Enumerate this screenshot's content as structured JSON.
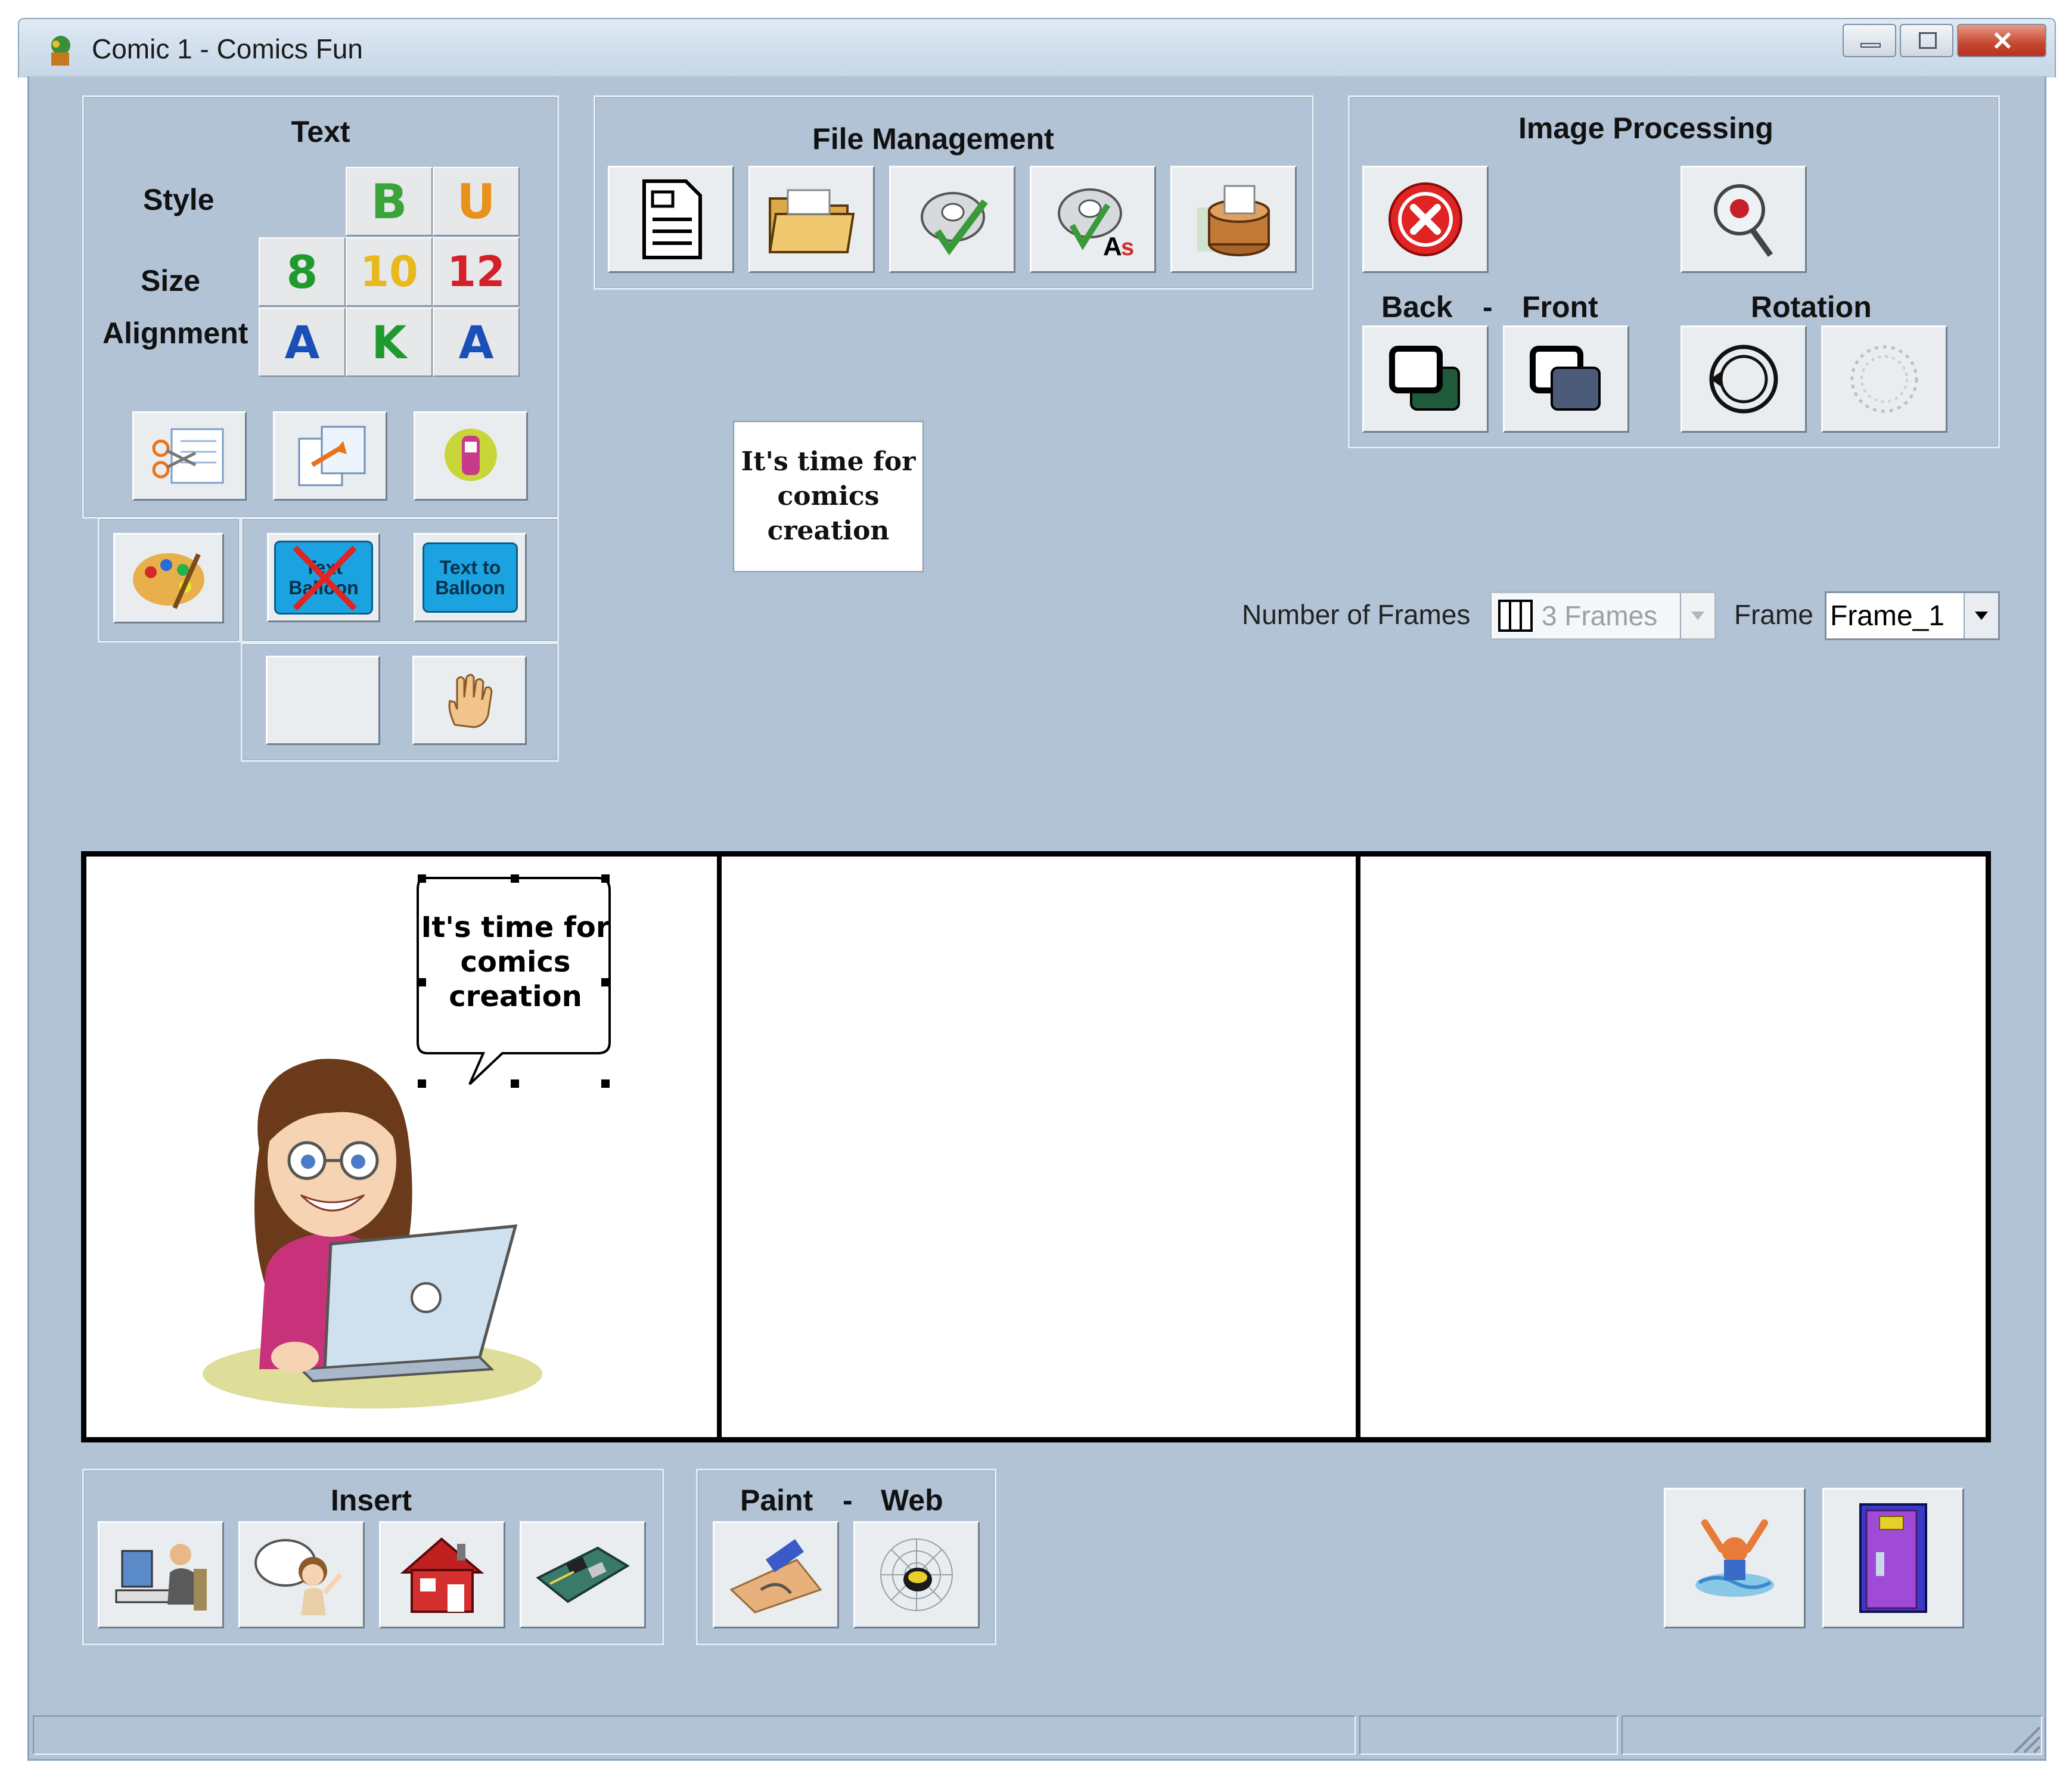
{
  "window": {
    "title": "Comic 1 - Comics Fun",
    "controls": {
      "minimize": "minimize-icon",
      "maximize": "maximize-icon",
      "close": "close-icon"
    }
  },
  "text_group": {
    "title": "Text",
    "style_label": "Style",
    "size_label": "Size",
    "alignment_label": "Alignment",
    "style_buttons": [
      "B",
      "U"
    ],
    "size_buttons": [
      "8",
      "10",
      "12"
    ],
    "alignment_buttons": [
      "A",
      "K",
      "A"
    ],
    "balloon_buttons": {
      "remove": "Text Balloon",
      "to": "Text to Balloon"
    }
  },
  "file_management": {
    "title": "File Management"
  },
  "image_processing": {
    "title": "Image Processing",
    "back_label": "Back",
    "dash": "-",
    "front_label": "Front",
    "rotation_label": "Rotation"
  },
  "preview": {
    "text": "It's time for comics creation"
  },
  "frames_bar": {
    "number_label": "Number of Frames",
    "number_value": "3 Frames",
    "frame_label": "Frame",
    "frame_value": "Frame_1"
  },
  "comic": {
    "frame_count": 3,
    "balloon_text": "It's time for comics creation"
  },
  "insert_group": {
    "title": "Insert"
  },
  "paint_web_group": {
    "title_left": "Paint",
    "dash": "-",
    "title_right": "Web"
  },
  "colors": {
    "window_bg": "#b2c3d6",
    "button_face": "#eaedf0",
    "balloon_blue": "#1aa3e0"
  }
}
